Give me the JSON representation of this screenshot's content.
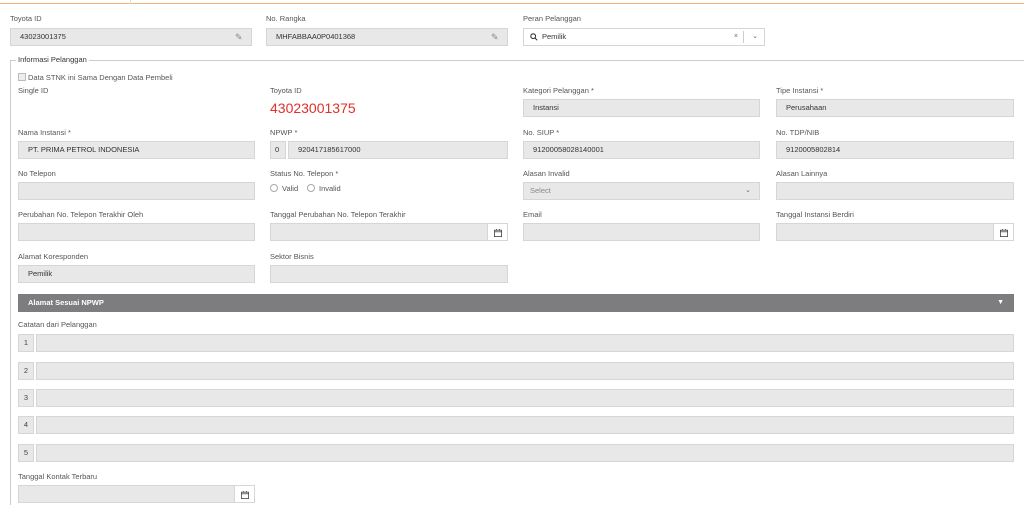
{
  "header": {
    "toyota_id_label": "Toyota ID",
    "toyota_id_value": "43023001375",
    "rangka_label": "No. Rangka",
    "rangka_value": "MHFABBAA0P0401368",
    "peran_label": "Peran Pelanggan",
    "peran_value": "Pemilik"
  },
  "section": {
    "title": "Informasi Pelanggan",
    "checkbox_label": "Data STNK ini Sama Dengan Data Pembeli"
  },
  "form": {
    "single_id_label": "Single ID",
    "toyota_id_label": "Toyota ID",
    "toyota_id_value": "43023001375",
    "kategori_label": "Kategori Pelanggan *",
    "kategori_value": "Instansi",
    "tipe_label": "Tipe Instansi *",
    "tipe_value": "Perusahaan",
    "nama_label": "Nama Instansi *",
    "nama_value": "PT. PRIMA PETROL INDONESIA",
    "npwp_label": "NPWP *",
    "npwp_prefix": "0",
    "npwp_value": "920417185617000",
    "siup_label": "No. SIUP *",
    "siup_value": "91200058028140001",
    "tdp_label": "No. TDP/NIB",
    "tdp_value": "9120005802814",
    "telepon_label": "No Telepon",
    "status_label": "Status No. Telepon *",
    "status_valid": "Valid",
    "status_invalid": "Invalid",
    "alasan_invalid_label": "Alasan Invalid",
    "alasan_invalid_placeholder": "Select",
    "alasan_lain_label": "Alasan Lainnya",
    "perubahan_oleh_label": "Perubahan No. Telepon Terakhir Oleh",
    "tgl_perubahan_label": "Tanggal Perubahan No. Telepon Terakhir",
    "email_label": "Email",
    "tgl_berdiri_label": "Tanggal Instansi Berdiri",
    "alamat_kores_label": "Alamat Koresponden",
    "alamat_kores_value": "Pemilik",
    "sektor_label": "Sektor Bisnis"
  },
  "npwp_section": {
    "title": "Alamat Sesuai NPWP"
  },
  "catatan": {
    "label": "Catatan dari Pelanggan",
    "rows": [
      "1",
      "2",
      "3",
      "4",
      "5"
    ]
  },
  "kontak": {
    "label": "Tanggal Kontak Terbaru"
  },
  "icons": {
    "calendar": "calendar-icon",
    "pencil": "pencil-icon",
    "search": "search-icon"
  },
  "colors": {
    "accent_red": "#e0312a",
    "section_bar": "#7d7d80",
    "top_border": "#f0b27a"
  }
}
